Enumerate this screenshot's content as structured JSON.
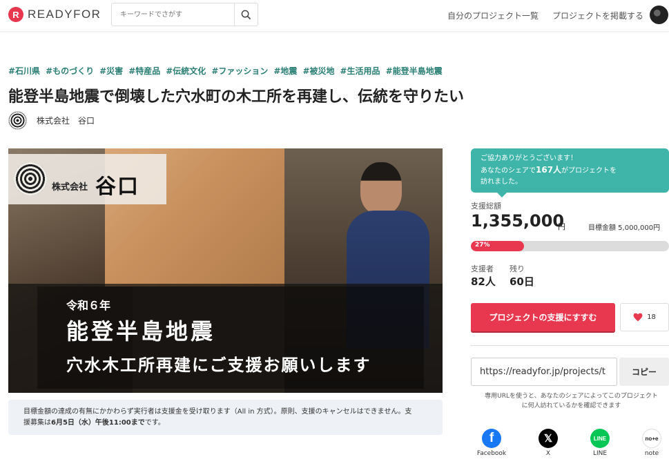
{
  "header": {
    "logo_mark": "R",
    "logo_text": "READYFOR",
    "search_placeholder": "キーワードでさがす",
    "nav_my_projects": "自分のプロジェクト一覧",
    "nav_post_project": "プロジェクトを掲載する"
  },
  "tags": [
    "#石川県",
    "#ものづくり",
    "#災害",
    "#特産品",
    "#伝統文化",
    "#ファッション",
    "#地震",
    "#被災地",
    "#生活用品",
    "#能登半島地震"
  ],
  "project": {
    "title": "能登半島地震で倒壊した穴水町の木工所を再建し、伝統を守りたい",
    "owner": "株式会社　谷口"
  },
  "hero": {
    "logo_small": "株式会社",
    "logo_big": "谷口",
    "line1": "令和６年",
    "line2": "能登半島地震",
    "line3": "穴水木工所再建にご支援お願いします"
  },
  "notice": {
    "text1": "目標金額の達成の有無にかかわらず実行者は支援金を受け取ります（All in 方式）。原則、支援のキャンセルはできません。支",
    "text2_prefix": "援募集は",
    "text2_bold": "6月5日（水）午後11:00まで",
    "text2_suffix": "です。"
  },
  "share_box": {
    "line1": "ご協力ありがとうございます！",
    "line2_prefix": "あなたのシェアで",
    "line2_count": "167人",
    "line2_suffix": "がプロジェクトを",
    "line3": "訪れました。"
  },
  "stats": {
    "total_label": "支援総額",
    "total_amount": "1,355,000",
    "total_unit": "円",
    "goal_label": "目標金額 5,000,000円",
    "progress_percent": 27,
    "progress_label": "27%",
    "supporters_label": "支援者",
    "supporters_value": "82人",
    "remaining_label": "残り",
    "remaining_value": "60日"
  },
  "actions": {
    "support_button": "プロジェクトの支援にすすむ",
    "like_count": "18",
    "share_url": "https://readyfor.jp/projects/t",
    "copy_button": "コピー",
    "url_note": "専用URLを使うと、あなたのシェアによってこのプロジェクトに何人訪れているかを確認できます"
  },
  "social": {
    "facebook": "Facebook",
    "x": "X",
    "line": "LINE",
    "note": "note",
    "note_logo": "no+e"
  },
  "colors": {
    "brand_red": "#e8384f",
    "tag_green": "#2a7f74",
    "share_teal": "#3fb5aa",
    "facebook_blue": "#1877f2",
    "line_green": "#06c755"
  }
}
